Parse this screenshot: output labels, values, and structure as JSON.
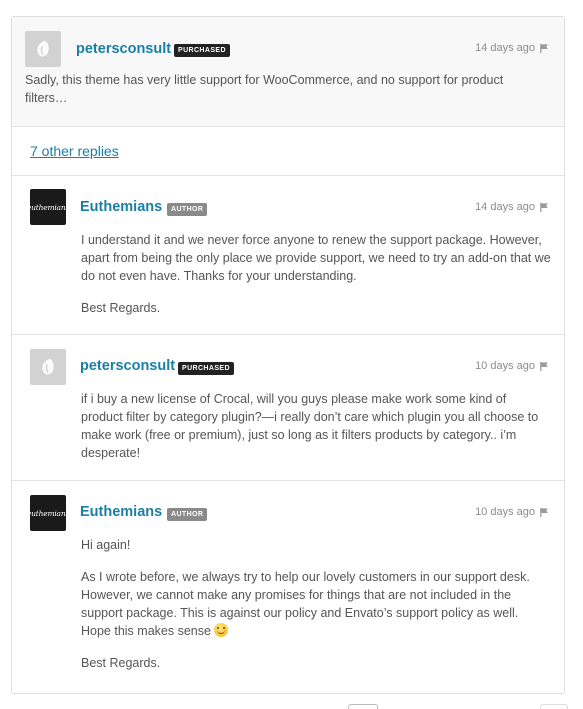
{
  "main_comment": {
    "username": "petersconsult",
    "badge": "PURCHASED",
    "time": "14 days ago",
    "avatar": "default-avatar-icon",
    "body": "Sadly, this theme has very little support for WooCommerce, and no support for product filters…"
  },
  "other_replies_link": "7 other replies",
  "replies": [
    {
      "username": "Euthemians",
      "badge": "AUTHOR",
      "time": "14 days ago",
      "avatar_text": "euthemians",
      "paragraphs": [
        "I understand it and we never force anyone to renew the support package. However, apart from being the only place we provide support, we need to try an add-on that we do not even have. Thanks for your understanding.",
        "Best Regards."
      ]
    },
    {
      "username": "petersconsult",
      "badge": "PURCHASED",
      "time": "10 days ago",
      "avatar": "default-avatar-icon",
      "paragraphs": [
        "if i buy a new license of Crocal, will you guys please make work some kind of product filter by category plugin?—i really don’t care which plugin you all choose to make work (free or premium), just so long as it filters products by category.. i’m desperate!"
      ]
    },
    {
      "username": "Euthemians",
      "badge": "AUTHOR",
      "time": "10 days ago",
      "avatar_text": "euthemians",
      "paragraphs": [
        "Hi again!",
        "As I wrote before, we always try to help our lovely customers in our support desk. However, we cannot make any promises for things that are not included in the support package. This is against our policy and Envato’s support policy as well. Hope this makes sense",
        "Best Regards."
      ]
    }
  ],
  "icons": {
    "flag": "flag-icon",
    "emoji": "smiley-emoji-icon"
  },
  "colors": {
    "link": "#1b7fa5",
    "purchased_badge": "#222222",
    "author_badge": "#8a8a8a"
  }
}
